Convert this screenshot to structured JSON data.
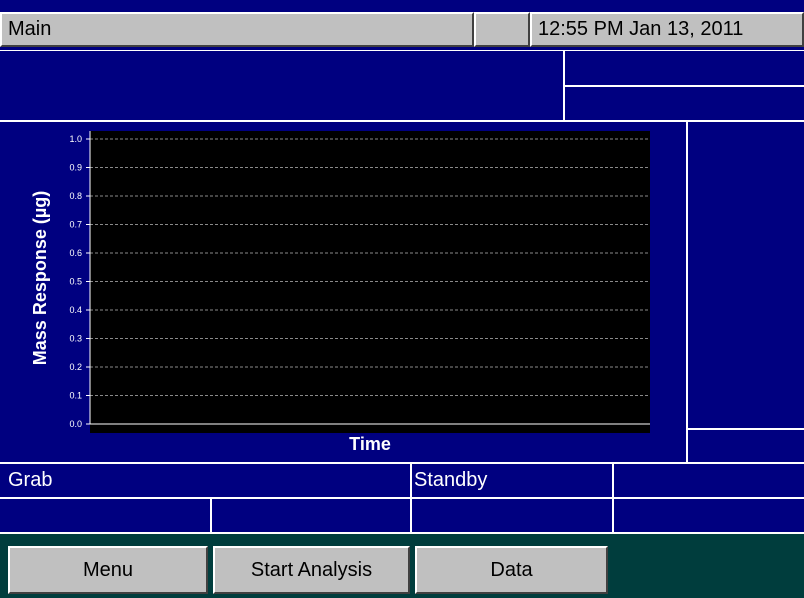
{
  "titlebar": {
    "screen_name": "Main",
    "blank_field": "",
    "datetime": "12:55 PM Jan 13, 2011"
  },
  "infobar": {
    "left": "",
    "right_top": "",
    "right_bottom": ""
  },
  "side_panel": {
    "top": "",
    "bottom": ""
  },
  "status": {
    "mode": "Grab",
    "state": "Standby",
    "row1_right": "",
    "row2_cell1": "",
    "row2_cell2": "",
    "row2_cell3": "",
    "row2_cell4": ""
  },
  "buttons": {
    "menu_label": "Menu",
    "start_label": "Start Analysis",
    "data_label": "Data"
  },
  "colors": {
    "panel_background": "#000080",
    "plot_background": "#000000",
    "button_bar": "#003d3d",
    "button_face": "#c0c0c0",
    "text_light": "#ffffff"
  },
  "chart_data": {
    "type": "line",
    "ylabel": "Mass Response (µg)",
    "xlabel": "Time",
    "ylim": [
      0.0,
      1.0
    ],
    "yticks": [
      "0.0",
      "0.1",
      "0.2",
      "0.3",
      "0.4",
      "0.5",
      "0.6",
      "0.7",
      "0.8",
      "0.9",
      "1.0"
    ],
    "grid": true,
    "grid_style": "dashed-horizontal",
    "series": []
  }
}
